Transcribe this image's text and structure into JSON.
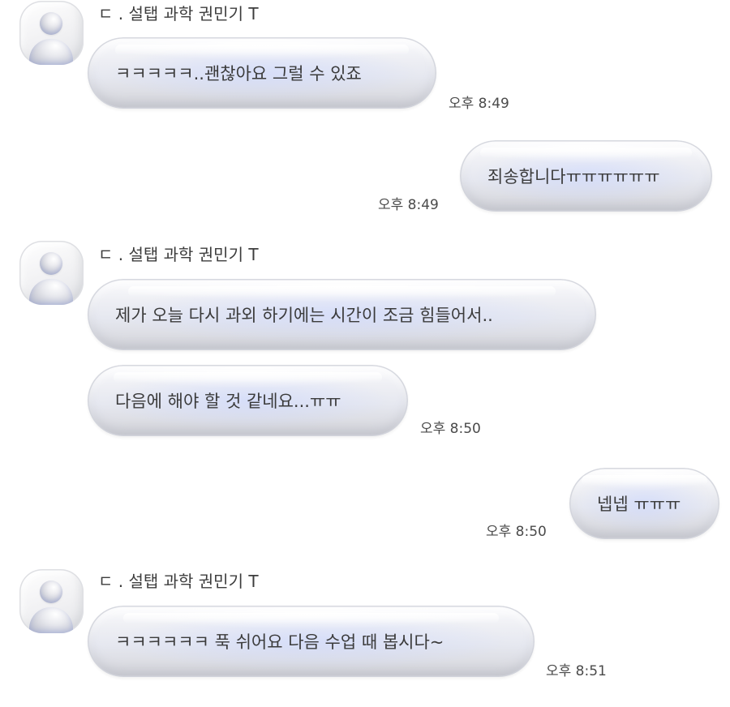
{
  "messages": [
    {
      "sender": "ㄷ . 설탭 과학 권민기 T",
      "text": "ㅋㅋㅋㅋㅋ..괜찮아요 그럴 수 있죠",
      "time": "오후 8:49"
    },
    {
      "text": "죄송합니다ㅠㅠㅠㅠㅠㅠ",
      "time": "오후 8:49"
    },
    {
      "sender": "ㄷ . 설탭 과학 권민기 T",
      "text": "제가 오늘 다시 과외 하기에는 시간이 조금 힘들어서.."
    },
    {
      "text": "다음에 해야 할 것 같네요...ㅠㅠ",
      "time": "오후 8:50"
    },
    {
      "text": "넵넵 ㅠㅠㅠ",
      "time": "오후 8:50"
    },
    {
      "sender": "ㄷ . 설탭 과학 권민기 T",
      "text": "ㅋㅋㅋㅋㅋㅋ 푹 쉬어요 다음 수업 때 봅시다~",
      "time": "오후 8:51"
    }
  ]
}
